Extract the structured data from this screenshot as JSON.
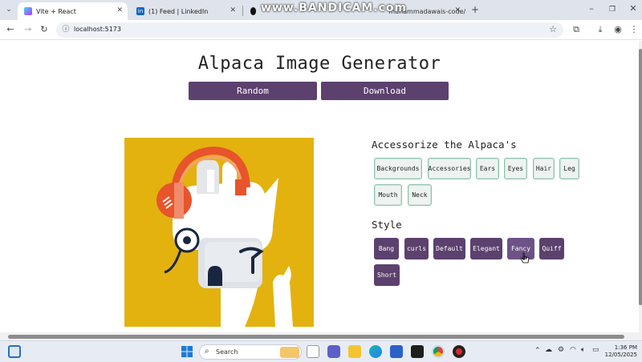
{
  "browser": {
    "tabs": [
      {
        "title": "Vite + React",
        "active": true
      },
      {
        "title": "(1) Feed | LinkedIn",
        "active": false
      },
      {
        "title": "muhammadawais-code/alpaca-...",
        "active": false
      }
    ],
    "url": "localhost:5173",
    "watermark": "www.BANDICAM.com"
  },
  "app": {
    "title": "Alpaca Image Generator",
    "random_label": "Random",
    "download_label": "Download",
    "accessorize_heading": "Accessorize the Alpaca's",
    "accessories": [
      "Backgrounds",
      "Accessories",
      "Ears",
      "Eyes",
      "Hair",
      "Leg",
      "Mouth",
      "Neck"
    ],
    "style_heading": "Style",
    "styles": [
      "Bang",
      "curls",
      "Default",
      "Elegant",
      "Fancy",
      "Quiff",
      "Short"
    ],
    "selected_style": "Fancy"
  },
  "taskbar": {
    "search_label": "Search",
    "time": "1:36 PM",
    "date": "12/05/2025"
  },
  "colors": {
    "accent": "#5c416e",
    "background_yellow": "#e3b20f",
    "headphones": "#e8542b",
    "accessory_border": "#8fc3ae"
  }
}
